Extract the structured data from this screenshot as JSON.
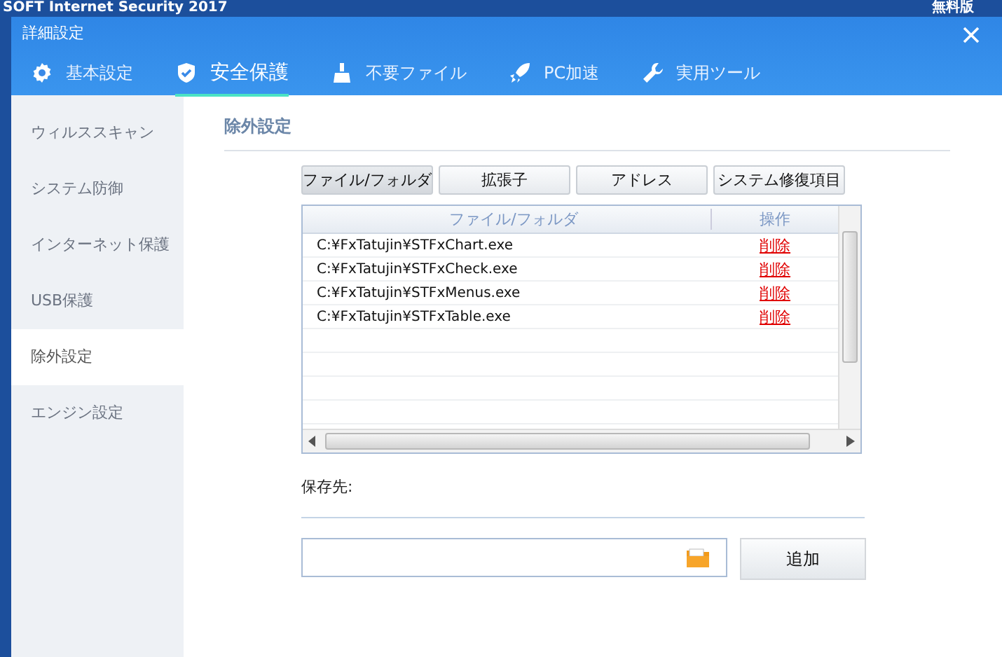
{
  "background_window": {
    "title": "SOFT Internet Security 2017",
    "edition": "無料版"
  },
  "window": {
    "title": "詳細設定"
  },
  "nav_tabs": [
    {
      "label": "基本設定",
      "kind": "gear",
      "selected": false
    },
    {
      "label": "安全保護",
      "kind": "shield",
      "selected": true
    },
    {
      "label": "不要ファイル",
      "kind": "broom",
      "selected": false
    },
    {
      "label": "PC加速",
      "kind": "rocket",
      "selected": false
    },
    {
      "label": "実用ツール",
      "kind": "wrench",
      "selected": false
    }
  ],
  "sidebar": {
    "items": [
      {
        "label": "ウィルススキャン",
        "selected": false
      },
      {
        "label": "システム防御",
        "selected": false
      },
      {
        "label": "インターネット保護",
        "selected": false
      },
      {
        "label": "USB保護",
        "selected": false
      },
      {
        "label": "除外設定",
        "selected": true
      },
      {
        "label": "エンジン設定",
        "selected": false
      }
    ]
  },
  "panel": {
    "heading": "除外設定",
    "category_tabs": [
      {
        "label": "ファイル/フォルダ",
        "selected": true
      },
      {
        "label": "拡張子",
        "selected": false
      },
      {
        "label": "アドレス",
        "selected": false
      },
      {
        "label": "システム修復項目",
        "selected": false
      }
    ],
    "table": {
      "columns": [
        "ファイル/フォルダ",
        "操作"
      ],
      "rows": [
        {
          "path": "C:¥FxTatujin¥STFxChart.exe",
          "action": "削除"
        },
        {
          "path": "C:¥FxTatujin¥STFxCheck.exe",
          "action": "削除"
        },
        {
          "path": "C:¥FxTatujin¥STFxMenus.exe",
          "action": "削除"
        },
        {
          "path": "C:¥FxTatujin¥STFxTable.exe",
          "action": "削除"
        }
      ]
    },
    "save_label": "保存先:",
    "add_button": "追加"
  }
}
